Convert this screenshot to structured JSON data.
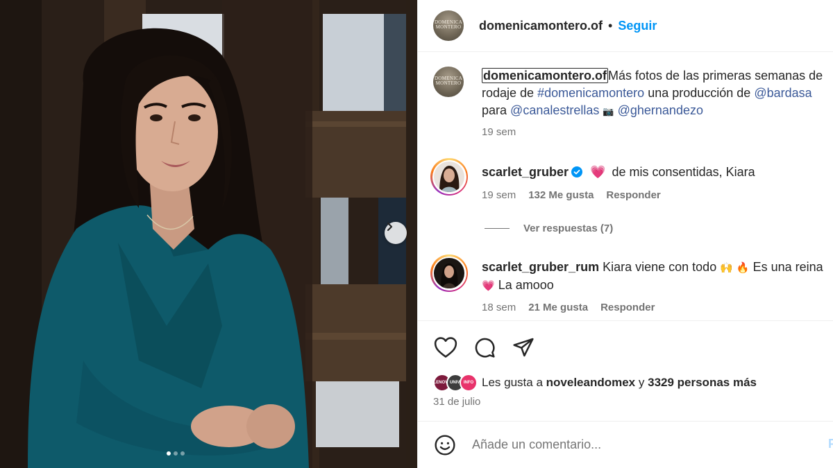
{
  "photo": {
    "next_icon": "chevron-right-icon",
    "carousel_total": 3,
    "carousel_active": 1
  },
  "header": {
    "username": "domenicamontero.of",
    "separator": "•",
    "follow_label": "Seguir",
    "avatar_logo_text": "DOMENICA MONTERO"
  },
  "caption": {
    "username": "domenicamontero.of",
    "text_1": "Más fotos de las primeras semanas de",
    "text_2": "rodaje de",
    "hashtag": "#domenicamontero",
    "text_3": "una producción de",
    "mention_1": "@bardasa",
    "text_4": "para",
    "mention_2": "@canalestrellas",
    "camera_emoji": "📷",
    "mention_3": "@ghernandezo",
    "time": "19 sem"
  },
  "comments": [
    {
      "username": "scarlet_gruber",
      "verified": true,
      "emoji": "💗",
      "text": "de mis consentidas, Kiara",
      "time": "19 sem",
      "likes": "132 Me gusta",
      "reply_label": "Responder"
    },
    {
      "username": "scarlet_gruber_rum",
      "text": "Kiara viene con todo",
      "emoji_1": "🙌",
      "emoji_2": "🔥",
      "text_2": "Es una reina",
      "emoji_3": "💗",
      "text_3": "La amooo",
      "time": "18 sem",
      "likes": "21 Me gusta",
      "reply_label": "Responder"
    }
  ],
  "view_replies": "Ver respuestas (7)",
  "actions": {
    "like_icon": "heart-icon",
    "comment_icon": "comment-icon",
    "share_icon": "send-icon"
  },
  "likes": {
    "prefix": "Les gusta a",
    "user": "noveleandomex",
    "conj": "y",
    "count": "3329 personas más",
    "avatar_labels": [
      "TELENOVELA",
      "UNIVI",
      "INFO"
    ]
  },
  "date": "31 de julio",
  "add_comment": {
    "placeholder": "Añade un comentario...",
    "post_label": "P",
    "emoji_icon": "smiley-icon"
  },
  "colors": {
    "accent": "#0095f6",
    "link": "#3b5998",
    "muted": "#737373",
    "blouse": "#0e5a6a"
  }
}
